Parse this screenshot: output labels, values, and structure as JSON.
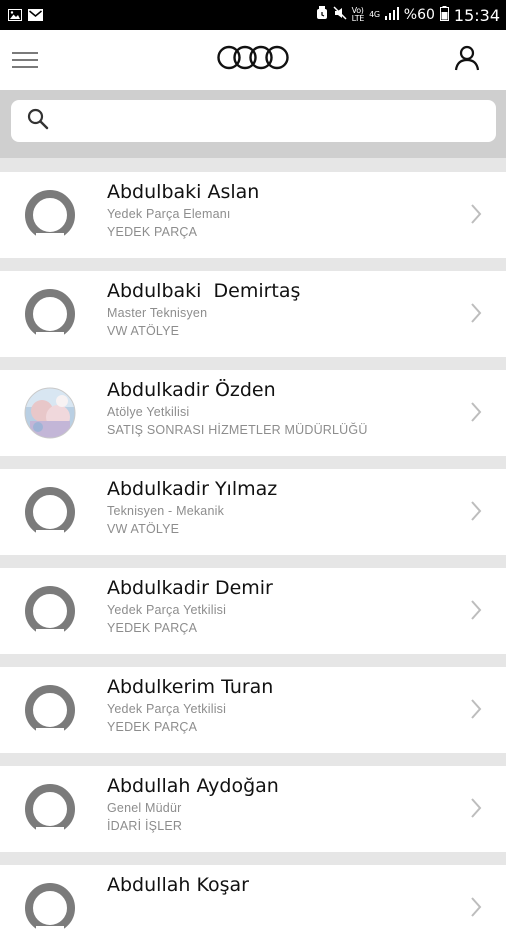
{
  "status_bar": {
    "time": "15:34",
    "battery_percent": "%60",
    "network_label_top": "Vo)",
    "network_label_bottom": "LTE",
    "net_gen": "4G"
  },
  "header": {
    "menu_icon": "hamburger-icon",
    "logo": "four-rings-logo",
    "profile_icon": "user-icon"
  },
  "search": {
    "placeholder": "",
    "value": ""
  },
  "contacts": [
    {
      "name": "Abdulbaki Aslan",
      "title": "Yedek Parça Elemanı",
      "department": "YEDEK PARÇA",
      "avatar": "default"
    },
    {
      "name": "Abdulbaki  Demirtaş",
      "title": "Master Teknisyen",
      "department": "VW ATÖLYE",
      "avatar": "default"
    },
    {
      "name": "Abdulkadir Özden",
      "title": "Atölye Yetkilisi",
      "department": "SATIŞ SONRASI HİZMETLER MÜDÜRLÜĞÜ",
      "avatar": "photo"
    },
    {
      "name": "Abdulkadir Yılmaz",
      "title": "Teknisyen - Mekanik",
      "department": "VW ATÖLYE",
      "avatar": "default"
    },
    {
      "name": "Abdulkadir Demir",
      "title": "Yedek Parça Yetkilisi",
      "department": "YEDEK PARÇA",
      "avatar": "default"
    },
    {
      "name": "Abdulkerim Turan",
      "title": "Yedek Parça Yetkilisi",
      "department": "YEDEK PARÇA",
      "avatar": "default"
    },
    {
      "name": "Abdullah Aydoğan",
      "title": "Genel Müdür",
      "department": "İDARİ İŞLER",
      "avatar": "default"
    },
    {
      "name": "Abdullah Koşar",
      "title": "",
      "department": "",
      "avatar": "default"
    }
  ]
}
